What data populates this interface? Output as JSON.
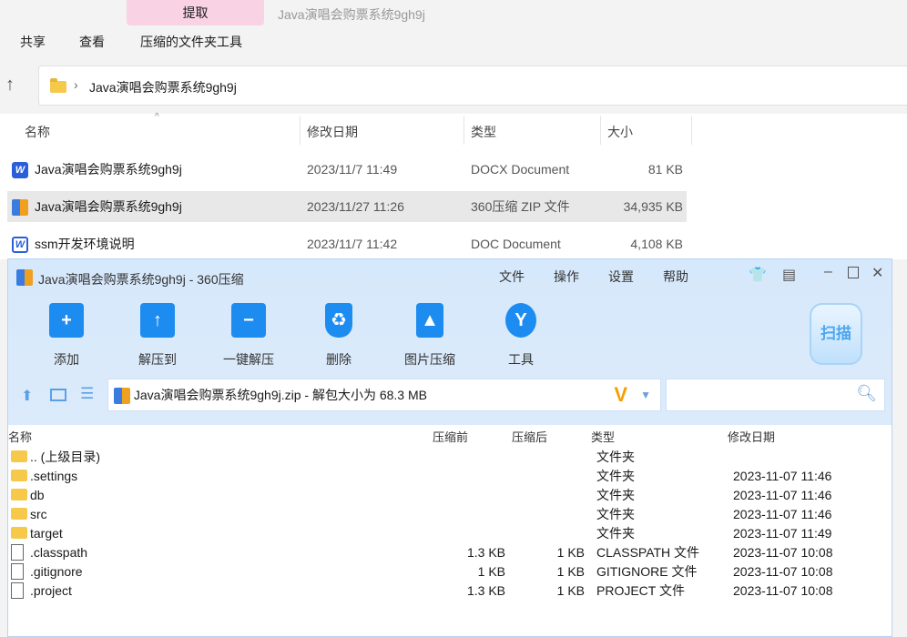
{
  "explorer": {
    "context_tab": "提取",
    "window_title": "Java演唱会购票系统9gh9j",
    "ribbon": [
      "共享",
      "查看",
      "压缩的文件夹工具"
    ],
    "address": "Java演唱会购票系统9gh9j",
    "columns": [
      "名称",
      "修改日期",
      "类型",
      "大小"
    ],
    "files": [
      {
        "name": "Java演唱会购票系统9gh9j",
        "date": "2023/11/7 11:49",
        "type": "DOCX Document",
        "size": "81 KB",
        "icon": "word-icon"
      },
      {
        "name": "Java演唱会购票系统9gh9j",
        "date": "2023/11/27 11:26",
        "type": "360压缩 ZIP 文件",
        "size": "34,935 KB",
        "icon": "zip-icon"
      },
      {
        "name": "ssm开发环境说明",
        "date": "2023/11/7 11:42",
        "type": "DOC Document",
        "size": "4,108 KB",
        "icon": "word-icon"
      }
    ]
  },
  "zip": {
    "title": "Java演唱会购票系统9gh9j - 360压缩",
    "menu": [
      "文件",
      "操作",
      "设置",
      "帮助"
    ],
    "toolbar": [
      {
        "label": "添加",
        "glyph": "+"
      },
      {
        "label": "解压到",
        "glyph": "↑"
      },
      {
        "label": "一键解压",
        "glyph": "−"
      },
      {
        "label": "删除",
        "glyph": "♻"
      },
      {
        "label": "图片压缩",
        "glyph": "▲"
      },
      {
        "label": "工具",
        "glyph": "Y"
      }
    ],
    "scan": "扫描",
    "path": "Java演唱会购票系统9gh9j.zip - 解包大小为 68.3 MB",
    "columns": [
      "名称",
      "压缩前",
      "压缩后",
      "类型",
      "修改日期"
    ],
    "rows": [
      {
        "name": ".. (上级目录)",
        "before": "",
        "after": "",
        "type": "文件夹",
        "date": "",
        "icon": "folder"
      },
      {
        "name": ".settings",
        "before": "",
        "after": "",
        "type": "文件夹",
        "date": "2023-11-07 11:46",
        "icon": "folder"
      },
      {
        "name": "db",
        "before": "",
        "after": "",
        "type": "文件夹",
        "date": "2023-11-07 11:46",
        "icon": "folder"
      },
      {
        "name": "src",
        "before": "",
        "after": "",
        "type": "文件夹",
        "date": "2023-11-07 11:46",
        "icon": "folder"
      },
      {
        "name": "target",
        "before": "",
        "after": "",
        "type": "文件夹",
        "date": "2023-11-07 11:49",
        "icon": "folder"
      },
      {
        "name": ".classpath",
        "before": "1.3 KB",
        "after": "1 KB",
        "type": "CLASSPATH 文件",
        "date": "2023-11-07 10:08",
        "icon": "file"
      },
      {
        "name": ".gitignore",
        "before": "1 KB",
        "after": "1 KB",
        "type": "GITIGNORE 文件",
        "date": "2023-11-07 10:08",
        "icon": "file"
      },
      {
        "name": ".project",
        "before": "1.3 KB",
        "after": "1 KB",
        "type": "PROJECT 文件",
        "date": "2023-11-07 10:08",
        "icon": "file"
      }
    ]
  }
}
